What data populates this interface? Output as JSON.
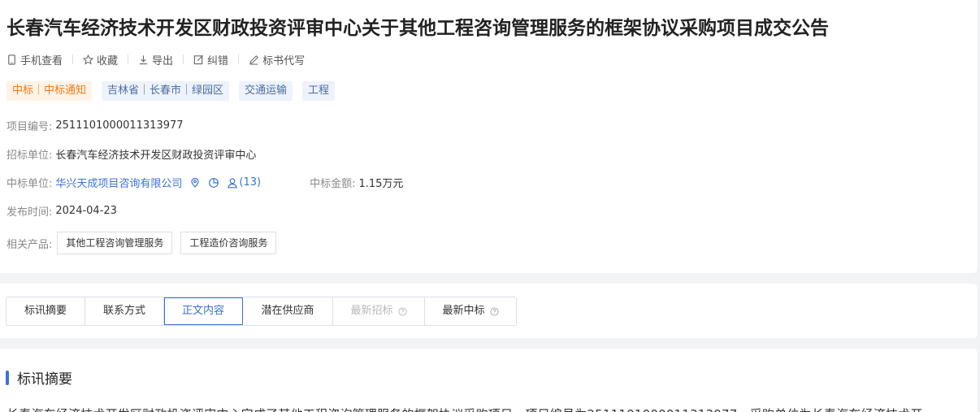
{
  "header": {
    "title": "长春汽车经济技术开发区财政投资评审中心关于其他工程咨询管理服务的框架协议采购项目成交公告"
  },
  "actions": [
    {
      "label": "手机查看",
      "icon": "mobile-icon"
    },
    {
      "label": "收藏",
      "icon": "star-icon"
    },
    {
      "label": "导出",
      "icon": "download-icon"
    },
    {
      "label": "纠错",
      "icon": "edit-icon"
    },
    {
      "label": "标书代写",
      "icon": "pen-icon"
    }
  ],
  "tags": [
    "中标｜中标通知",
    "吉林省｜长春市｜绿园区",
    "交通运输",
    "工程"
  ],
  "info": {
    "project_no_label": "项目编号:",
    "project_no": "2511101000011313977",
    "tenderer_label": "招标单位:",
    "tenderer": "长春汽车经济技术开发区财政投资评审中心",
    "winner_label": "中标单位:",
    "winner": "华兴天成项目咨询有限公司",
    "winner_count": "(13)",
    "amount_label": "中标金额:",
    "amount": "1.15万元",
    "publish_label": "发布时间:",
    "publish_date": "2024-04-23",
    "products_label": "相关产品:",
    "products": [
      "其他工程咨询管理服务",
      "工程造价咨询服务"
    ]
  },
  "tabs": [
    {
      "label": "标讯摘要",
      "state": "normal"
    },
    {
      "label": "联系方式",
      "state": "normal"
    },
    {
      "label": "正文内容",
      "state": "active"
    },
    {
      "label": "潜在供应商",
      "state": "normal"
    },
    {
      "label": "最新招标",
      "state": "disabled"
    },
    {
      "label": "最新中标",
      "state": "normal"
    }
  ],
  "summary": {
    "title": "标讯摘要",
    "text": "长春汽车经济技术开发区财政投资评审中心完成了其他工程咨询管理服务的框架协议采购项目，项目编号为2511101000011313977，采购单位为长春汽车经济技术开"
  },
  "colors": {
    "accent": "#3c73d4",
    "orange": "#ee7a1c"
  }
}
